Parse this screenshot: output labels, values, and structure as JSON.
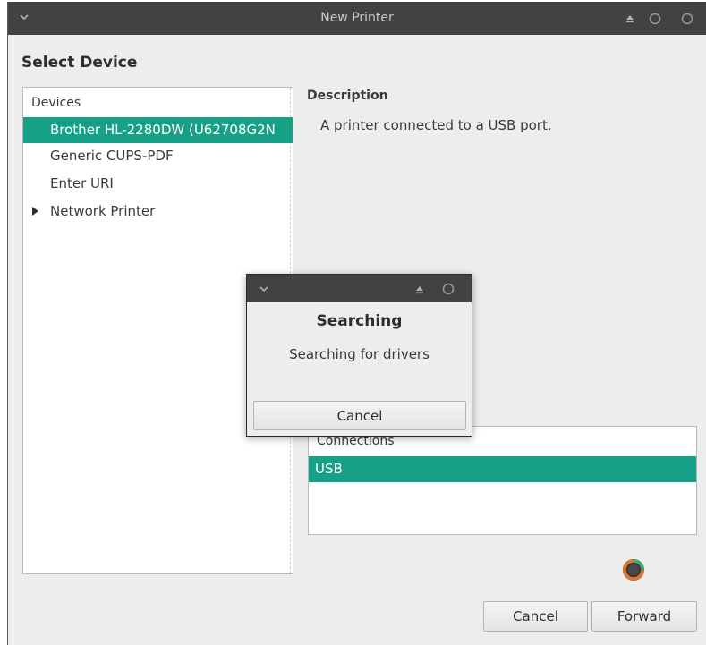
{
  "window": {
    "title": "New Printer"
  },
  "page": {
    "heading": "Select Device"
  },
  "devices": {
    "header": "Devices",
    "items": [
      {
        "label": "Brother HL-2280DW (U62708G2N",
        "selected": true
      },
      {
        "label": "Generic CUPS-PDF",
        "selected": false
      },
      {
        "label": "Enter URI",
        "selected": false
      },
      {
        "label": "Network Printer",
        "selected": false,
        "expandable": true
      }
    ]
  },
  "description": {
    "title": "Description",
    "text": "A printer connected to a USB port."
  },
  "connections": {
    "header": "Connections",
    "items": [
      {
        "label": "USB",
        "selected": true
      }
    ]
  },
  "buttons": {
    "cancel": "Cancel",
    "forward": "Forward"
  },
  "dialog": {
    "heading": "Searching",
    "message": "Searching for drivers",
    "cancel": "Cancel"
  },
  "colors": {
    "accent": "#16a085",
    "titlebar": "#424242",
    "background": "#ededed"
  },
  "icons": {
    "window_menu": "chevron-down-icon",
    "eject": "eject-icon",
    "window_control": "circle-icon",
    "spinner": "loading-spinner-icon"
  }
}
